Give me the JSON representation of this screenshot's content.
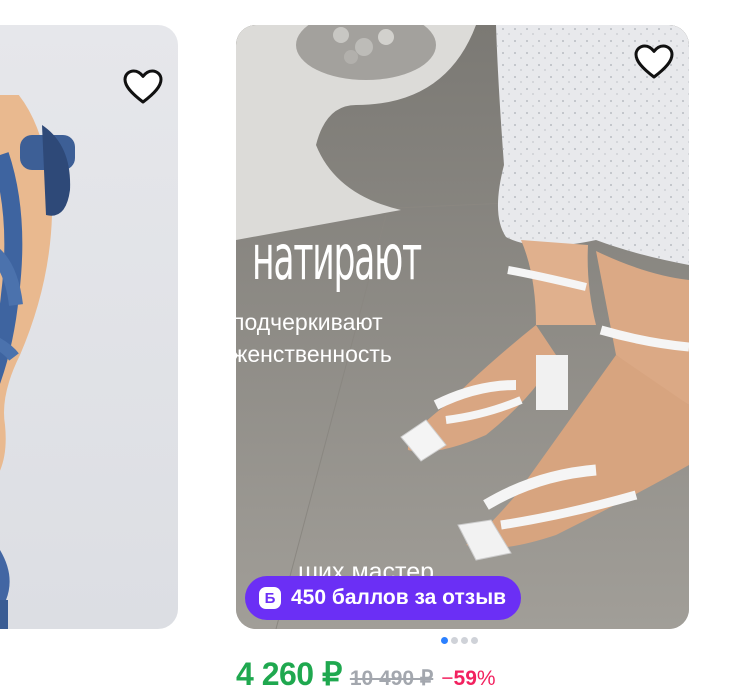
{
  "product": {
    "promo_headline": "натирают",
    "promo_line1": "подчеркивают",
    "promo_line2": "женственность",
    "promo_bottom": "ших мастер",
    "review_badge_icon": "Б",
    "review_badge_text": "450 баллов за отзыв",
    "price_current": "4 260 ₽",
    "price_old": "10 490 ₽",
    "discount_sign": "−",
    "discount_value": "59",
    "discount_unit": "%"
  },
  "carousel": {
    "slides": 4,
    "active": 1
  },
  "colors": {
    "price": "#1fa84f",
    "discount": "#f2215f",
    "badge": "#6b2ff5",
    "dot_active": "#2b80ff"
  }
}
